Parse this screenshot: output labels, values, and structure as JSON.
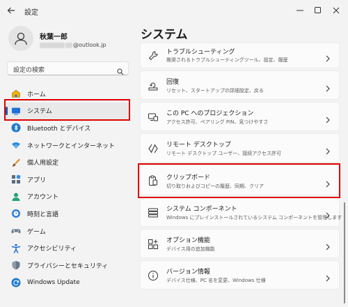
{
  "app": {
    "title": "設定"
  },
  "profile": {
    "name": "秋葉一郎",
    "email_suffix": "@outlook.jp"
  },
  "search": {
    "placeholder": "設定の検索"
  },
  "sidebar": {
    "items": [
      {
        "label": "ホーム",
        "icon": "home-icon"
      },
      {
        "label": "システム",
        "icon": "system-icon",
        "selected": true
      },
      {
        "label": "Bluetooth とデバイス",
        "icon": "bluetooth-icon"
      },
      {
        "label": "ネットワークとインターネット",
        "icon": "wifi-icon"
      },
      {
        "label": "個人用設定",
        "icon": "brush-icon"
      },
      {
        "label": "アプリ",
        "icon": "apps-icon"
      },
      {
        "label": "アカウント",
        "icon": "account-icon"
      },
      {
        "label": "時刻と言語",
        "icon": "clock-globe-icon"
      },
      {
        "label": "ゲーム",
        "icon": "gamepad-icon"
      },
      {
        "label": "アクセシビリティ",
        "icon": "accessibility-icon"
      },
      {
        "label": "プライバシーとセキュリティ",
        "icon": "shield-icon"
      },
      {
        "label": "Windows Update",
        "icon": "update-icon"
      }
    ]
  },
  "main": {
    "title": "システム",
    "cards": [
      {
        "title": "トラブルシューティング",
        "desc": "推奨されるトラブルシューティングツール、設定、履歴",
        "icon": "wrench-icon"
      },
      {
        "title": "回復",
        "desc": "リセット、スタートアップの詳細設定、戻る",
        "icon": "recovery-icon"
      },
      {
        "title": "この PC へのプロジェクション",
        "desc": "アクセス許可、ペアリング PIN、見つけやすさ",
        "icon": "projection-icon"
      },
      {
        "title": "リモート デスクトップ",
        "desc": "リモート デスクトップ ユーザー、接続アクセス許可",
        "icon": "remote-desktop-icon"
      },
      {
        "title": "クリップボード",
        "desc": "切り取りおよびコピーの履歴、同期、クリア",
        "icon": "clipboard-icon"
      },
      {
        "title": "システム コンポーネント",
        "desc": "Windows にプレインストールされているシステム コンポーネントを管理します",
        "icon": "components-icon"
      },
      {
        "title": "オプション機能",
        "desc": "デバイス用の追加機能",
        "icon": "optional-features-icon"
      },
      {
        "title": "バージョン情報",
        "desc": "デバイス仕様、PC 名を変更、Windows 仕様",
        "icon": "info-icon"
      }
    ]
  },
  "colors": {
    "accent": "#005fb8",
    "highlight": "#e00000"
  }
}
